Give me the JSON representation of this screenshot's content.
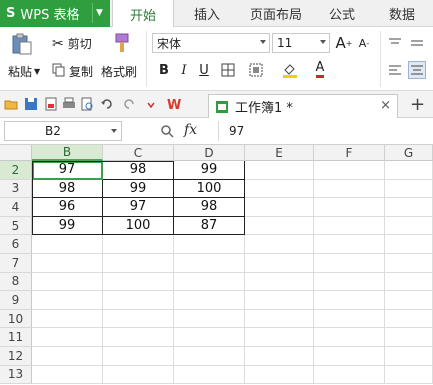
{
  "app": {
    "logo": "S",
    "name": "WPS 表格"
  },
  "menu_tabs": [
    "开始",
    "插入",
    "页面布局",
    "公式",
    "数据"
  ],
  "ribbon": {
    "paste": "粘贴",
    "cut": "剪切",
    "copy": "复制",
    "format_painter": "格式刷",
    "font_name": "宋体",
    "font_size": "11",
    "bold": "B",
    "italic": "I",
    "underline": "U",
    "grow": "A",
    "shrink": "A",
    "font_color": "A"
  },
  "doc_tab": {
    "title": "工作簿1 *",
    "close": "×",
    "new": "+"
  },
  "formula_bar": {
    "name_box": "B2",
    "fx": "fx",
    "value": "97"
  },
  "grid": {
    "columns": [
      "B",
      "C",
      "D",
      "E",
      "F",
      "G"
    ],
    "rows": [
      "2",
      "3",
      "4",
      "5",
      "6",
      "7",
      "8",
      "9",
      "10",
      "11",
      "12",
      "13"
    ],
    "data": [
      [
        "97",
        "98",
        "99"
      ],
      [
        "98",
        "99",
        "100"
      ],
      [
        "96",
        "97",
        "98"
      ],
      [
        "99",
        "100",
        "87"
      ]
    ]
  },
  "colors": {
    "accent": "#2f9e3e",
    "selection": "#d9ead3"
  }
}
